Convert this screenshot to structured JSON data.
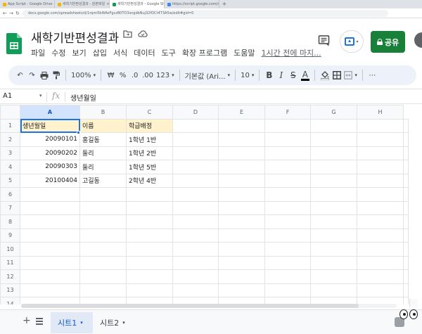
{
  "browser": {
    "tabs": [
      {
        "label": "App Script - Google Drive"
      },
      {
        "label": "새학기반편성결과 - 원본파일"
      },
      {
        "label": "새학기반편성결과 - Google Sh"
      },
      {
        "label": "https://script.google.com/macr"
      }
    ],
    "url": "docs.google.com/spreadsheets/d/1rqmi5kWAvFgcz80TO3sngdbNuj32fOCt4T3A5w/edit#gid=0"
  },
  "doc": {
    "title": "새학기반편성결과",
    "menus": [
      "파일",
      "수정",
      "보기",
      "삽입",
      "서식",
      "데이터",
      "도구",
      "확장 프로그램",
      "도움말"
    ],
    "last_edit": "1시간 전에 마지...",
    "share_label": "공유"
  },
  "toolbar": {
    "zoom": "100%",
    "currency": "₩",
    "percent": "%",
    "dec_decrease": ".0",
    "dec_increase": ".00",
    "format_more": "123",
    "font": "기본값 (Ari...",
    "font_size": "10",
    "bold": "B",
    "italic": "I",
    "strike": "S",
    "text_color": "A",
    "more": "⋯"
  },
  "formula": {
    "cell_ref": "A1",
    "fx": "fx",
    "content": "생년월일"
  },
  "grid": {
    "columns": [
      "A",
      "B",
      "C",
      "D",
      "E",
      "F",
      "G",
      "H"
    ],
    "rows": [
      {
        "n": "1",
        "a": "생년월일",
        "b": "이름",
        "c": "학급배정"
      },
      {
        "n": "2",
        "a": "20090101",
        "b": "홍길동",
        "c": "1학년 1반"
      },
      {
        "n": "3",
        "a": "20090202",
        "b": "둘리",
        "c": "1학년 2반"
      },
      {
        "n": "4",
        "a": "20090303",
        "b": "둘리",
        "c": "1학년 5반"
      },
      {
        "n": "5",
        "a": "20100404",
        "b": "고길동",
        "c": "2학년 4반"
      },
      {
        "n": "6",
        "a": "",
        "b": "",
        "c": ""
      },
      {
        "n": "7",
        "a": "",
        "b": "",
        "c": ""
      },
      {
        "n": "8",
        "a": "",
        "b": "",
        "c": ""
      },
      {
        "n": "9",
        "a": "",
        "b": "",
        "c": ""
      },
      {
        "n": "10",
        "a": "",
        "b": "",
        "c": ""
      },
      {
        "n": "11",
        "a": "",
        "b": "",
        "c": ""
      },
      {
        "n": "12",
        "a": "",
        "b": "",
        "c": ""
      },
      {
        "n": "13",
        "a": "",
        "b": "",
        "c": ""
      },
      {
        "n": "14",
        "a": "",
        "b": "",
        "c": ""
      }
    ]
  },
  "sheets": [
    {
      "label": "시트1",
      "active": true
    },
    {
      "label": "시트2",
      "active": false
    }
  ],
  "icons": {
    "add_sheet": "+",
    "sheet_tab_caret": "▾"
  },
  "colors": {
    "accent": "#1a73e8",
    "share": "#188038",
    "header_fill": "#fff2cc",
    "sheets_green": "#0f9d58"
  }
}
